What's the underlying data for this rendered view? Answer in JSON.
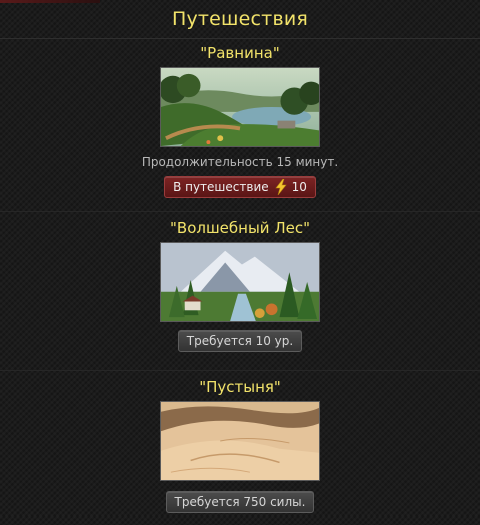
{
  "header": {
    "title": "Путешествия"
  },
  "trips": [
    {
      "title": "\"Равнина\"",
      "image_icon": "plains-landscape-image",
      "duration_text": "Продолжительность 15 минут.",
      "button": {
        "label": "В путешествие",
        "cost": "10",
        "icon": "lightning-icon",
        "style": "red"
      }
    },
    {
      "title": "\"Волшебный Лес\"",
      "image_icon": "magic-forest-landscape-image",
      "button": {
        "label": "Требуется 10 ур.",
        "style": "gray"
      }
    },
    {
      "title": "\"Пустыня\"",
      "image_icon": "desert-landscape-image",
      "button": {
        "label": "Требуется 750 силы.",
        "style": "gray"
      }
    }
  ],
  "colors": {
    "title_yellow": "#f2e36a",
    "button_red": "#6b1c1c",
    "button_gray": "#404040",
    "background": "#1c1c1c"
  }
}
